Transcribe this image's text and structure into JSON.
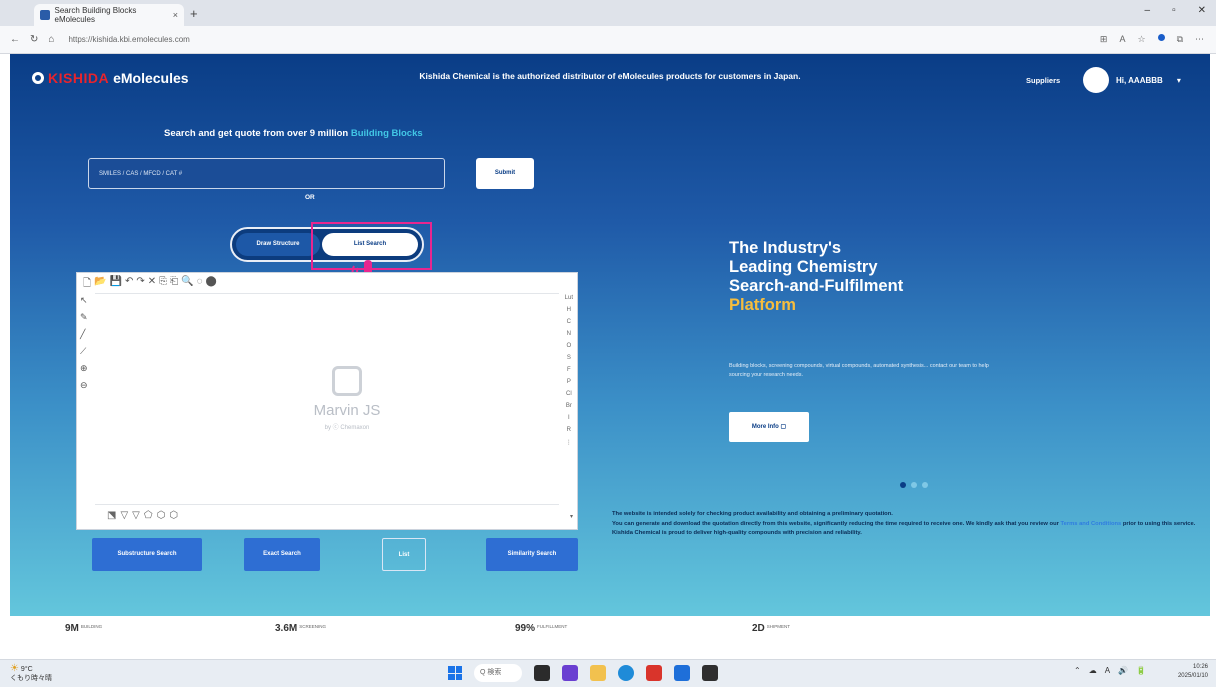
{
  "browser": {
    "tab_title": "Search Building Blocks eMolecules",
    "tab_close": "×",
    "new_tab": "+",
    "url": "https://kishida.kbi.emolecules.com",
    "window_controls": [
      "–",
      "▫",
      "✕"
    ],
    "accent": "#1a5dc9"
  },
  "header": {
    "brand_red": "KISHIDA",
    "brand_white": "eMolecules",
    "banner": "Kishida Chemical is the authorized distributor of eMolecules products for customers in Japan.",
    "suppliers": "Suppliers",
    "user": "Hi, AAABBB",
    "user_caret": "▾"
  },
  "search": {
    "title_prefix": "Search and get quote from over 9 million ",
    "title_highlight": "Building Blocks",
    "input_value": "SMILES / CAS / MFCD / CAT #",
    "submit": "Submit",
    "or": "OR",
    "toggle_left": "Draw Structure",
    "toggle_right": "List Search"
  },
  "editor": {
    "logo_title": "Marvin JS",
    "logo_sub": "by ⓒ Chemaxon",
    "toolbar_icons": [
      "🗋",
      "📂",
      "💾",
      "↶",
      "↷",
      "✕",
      "⎘",
      "⎗",
      "🔍",
      "◌",
      "⬤"
    ],
    "left_icons": [
      "↖",
      "✎",
      "╱",
      "⟋",
      "⊕",
      "⊖"
    ],
    "right_elements": [
      "Lut",
      "H",
      "C",
      "N",
      "O",
      "S",
      "F",
      "P",
      "Cl",
      "Br",
      "I",
      "R",
      "⋮"
    ],
    "bottom_icons": [
      "⬔",
      "▽",
      "▽",
      "⬠",
      "⬡",
      "⬡"
    ]
  },
  "actions": {
    "substructure": "Substructure Search",
    "exact": "Exact Search",
    "list": "List",
    "similarity": "Similarity Search"
  },
  "promo": {
    "headline_1": "The Industry's",
    "headline_2": "Leading Chemistry",
    "headline_3": "Search-and-Fulfilment",
    "headline_gold": "Platform",
    "desc": "Building blocks, screening compounds, virtual compounds, automated synthesis... contact our team to help sourcing your research needs.",
    "more_info": "More Info ▢",
    "gold_color": "#f6bd3d"
  },
  "notice": {
    "line1": "The website is intended solely for checking product availability and obtaining a preliminary quotation.",
    "line2": "You can generate and download the quotation directly from this website, significantly reducing the time required to receive one. We kindly ask that you review our ",
    "link": "Terms and Conditions",
    "line3": " prior to using this service. Kishida Chemical is proud to deliver high-quality compounds with precision and reliability."
  },
  "stats": [
    {
      "num": "9M",
      "lbl": "BUILDING"
    },
    {
      "num": "3.6M",
      "lbl": "SCREENING"
    },
    {
      "num": "99%",
      "lbl": "FULFILLMENT"
    },
    {
      "num": "2D",
      "lbl": "SHIPMENT"
    }
  ],
  "taskbar": {
    "weather_temp": "9°C",
    "weather_desc": "くもり時々晴",
    "search": "Q 検索",
    "tray": [
      "⌃",
      "☁",
      "A",
      "🔊",
      "🔋"
    ],
    "time": "10:26",
    "date": "2025/01/10"
  }
}
